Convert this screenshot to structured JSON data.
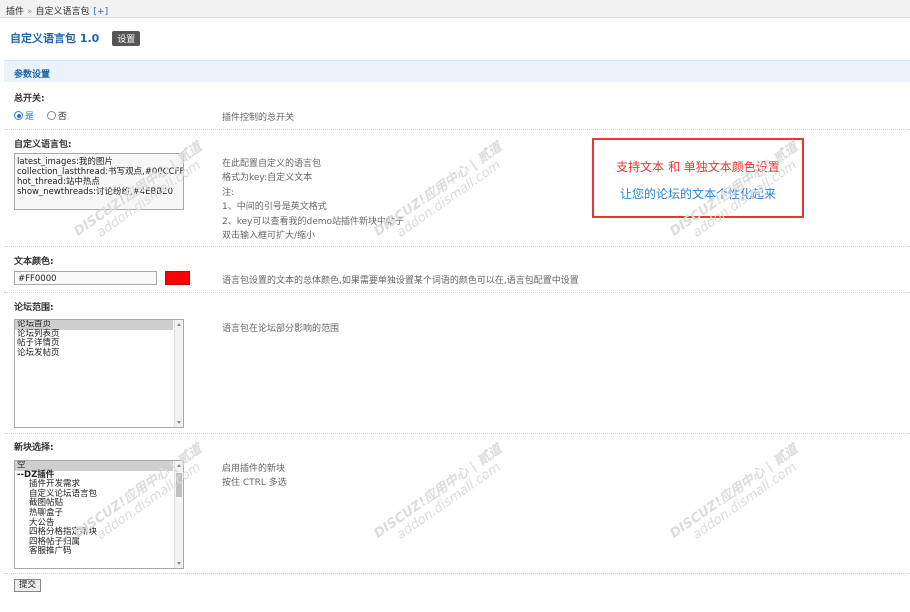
{
  "breadcrumb": {
    "root": "插件",
    "separator": "»",
    "current": "自定义语言包",
    "add": "[+]"
  },
  "header": {
    "title": "自定义语言包 1.0",
    "settings_button": "设置"
  },
  "section": {
    "title": "参数设置"
  },
  "switch_field": {
    "label": "总开关:",
    "options": [
      {
        "label": "是",
        "selected": true
      },
      {
        "label": "否",
        "selected": false
      }
    ],
    "comment": "插件控制的总开关"
  },
  "lang_field": {
    "label": "自定义语言包:",
    "value": "latest_images:我的图片\ncollection_lastthread:书写观点,#00CCFF\nhot_thread:站中热点\nshow_newthreads:讨论纷纷,#4EBB20",
    "comment": "在此配置自定义的语言包\n格式为key:自定义文本\n注:\n1、中间的引号是英文格式\n2、key可以查看我的demo站插件新块中帖子\n双击输入框可扩大/缩小"
  },
  "color_field": {
    "label": "文本颜色:",
    "value": "#FF0000",
    "swatch_color": "#FF0000",
    "comment": "语言包设置的文本的总体颜色,如果需要单独设置某个词语的颜色可以在,语言包配置中设置"
  },
  "forum_field": {
    "label": "论坛范围:",
    "options": [
      {
        "label": "论坛首页",
        "selected": true
      },
      {
        "label": "论坛列表页",
        "selected": false
      },
      {
        "label": "帖子详情页",
        "selected": false
      },
      {
        "label": "论坛发帖页",
        "selected": false
      }
    ],
    "comment": "语言包在论坛部分影响的范围"
  },
  "block_field": {
    "label": "新块选择:",
    "options": [
      {
        "label": "空",
        "selected": true,
        "kind": "plain"
      },
      {
        "label": "--DZ插件",
        "selected": false,
        "kind": "group"
      },
      {
        "label": "插件开发需求",
        "selected": false,
        "kind": "indent"
      },
      {
        "label": "自定义论坛语言包",
        "selected": false,
        "kind": "indent"
      },
      {
        "label": "截图帖贴",
        "selected": false,
        "kind": "indent"
      },
      {
        "label": "热聊盒子",
        "selected": false,
        "kind": "indent"
      },
      {
        "label": "大公告",
        "selected": false,
        "kind": "indent"
      },
      {
        "label": "四格分格指定新块",
        "selected": false,
        "kind": "indent"
      },
      {
        "label": "四格帖子归属",
        "selected": false,
        "kind": "indent"
      },
      {
        "label": "客服推广码",
        "selected": false,
        "kind": "indent"
      }
    ],
    "comment": "启用插件的新块\n按住 CTRL 多选"
  },
  "submit": {
    "label": "提交"
  },
  "callout": {
    "line1": "支持文本 和 单独文本颜色设置",
    "line2": "让您的论坛的文本个性化起来"
  },
  "watermark": {
    "line1": "DISCUZ!应用中心 | 贰道",
    "line2": "addon.dismall.com"
  },
  "colors": {
    "link": "#2366a8",
    "section_bg": "#eaf3fb",
    "callout_border": "#e33",
    "callout_red": "#e33",
    "callout_blue": "#2a86d6"
  }
}
